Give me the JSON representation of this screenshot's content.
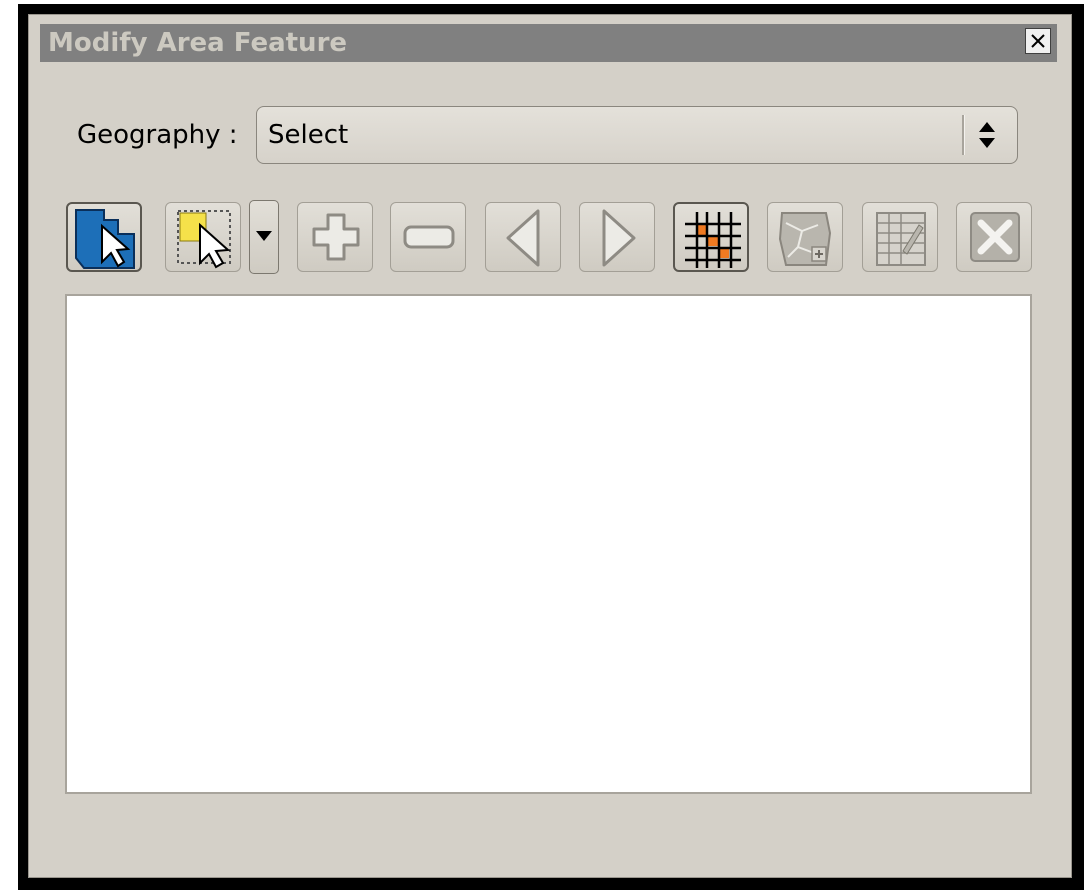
{
  "window": {
    "title": "Modify Area Feature",
    "close_icon": "close-icon"
  },
  "geography": {
    "label": "Geography :",
    "selected": "Select"
  },
  "toolbar": {
    "buttons": [
      {
        "icon": "select-area-feature-icon"
      },
      {
        "icon": "rectangle-select-icon"
      },
      {
        "icon": "dropdown-arrow-icon"
      },
      {
        "icon": "add-icon"
      },
      {
        "icon": "remove-icon"
      },
      {
        "icon": "previous-icon"
      },
      {
        "icon": "next-icon"
      },
      {
        "icon": "grid-zoom-icon"
      },
      {
        "icon": "map-edit-icon"
      },
      {
        "icon": "table-edit-icon"
      },
      {
        "icon": "delete-icon"
      }
    ]
  },
  "colors": {
    "dialog_bg": "#d4d0c8",
    "titlebar_bg": "#808080",
    "feature_blue": "#1d6fb8",
    "select_yellow": "#f5e14a",
    "grid_orange": "#f07a22"
  }
}
